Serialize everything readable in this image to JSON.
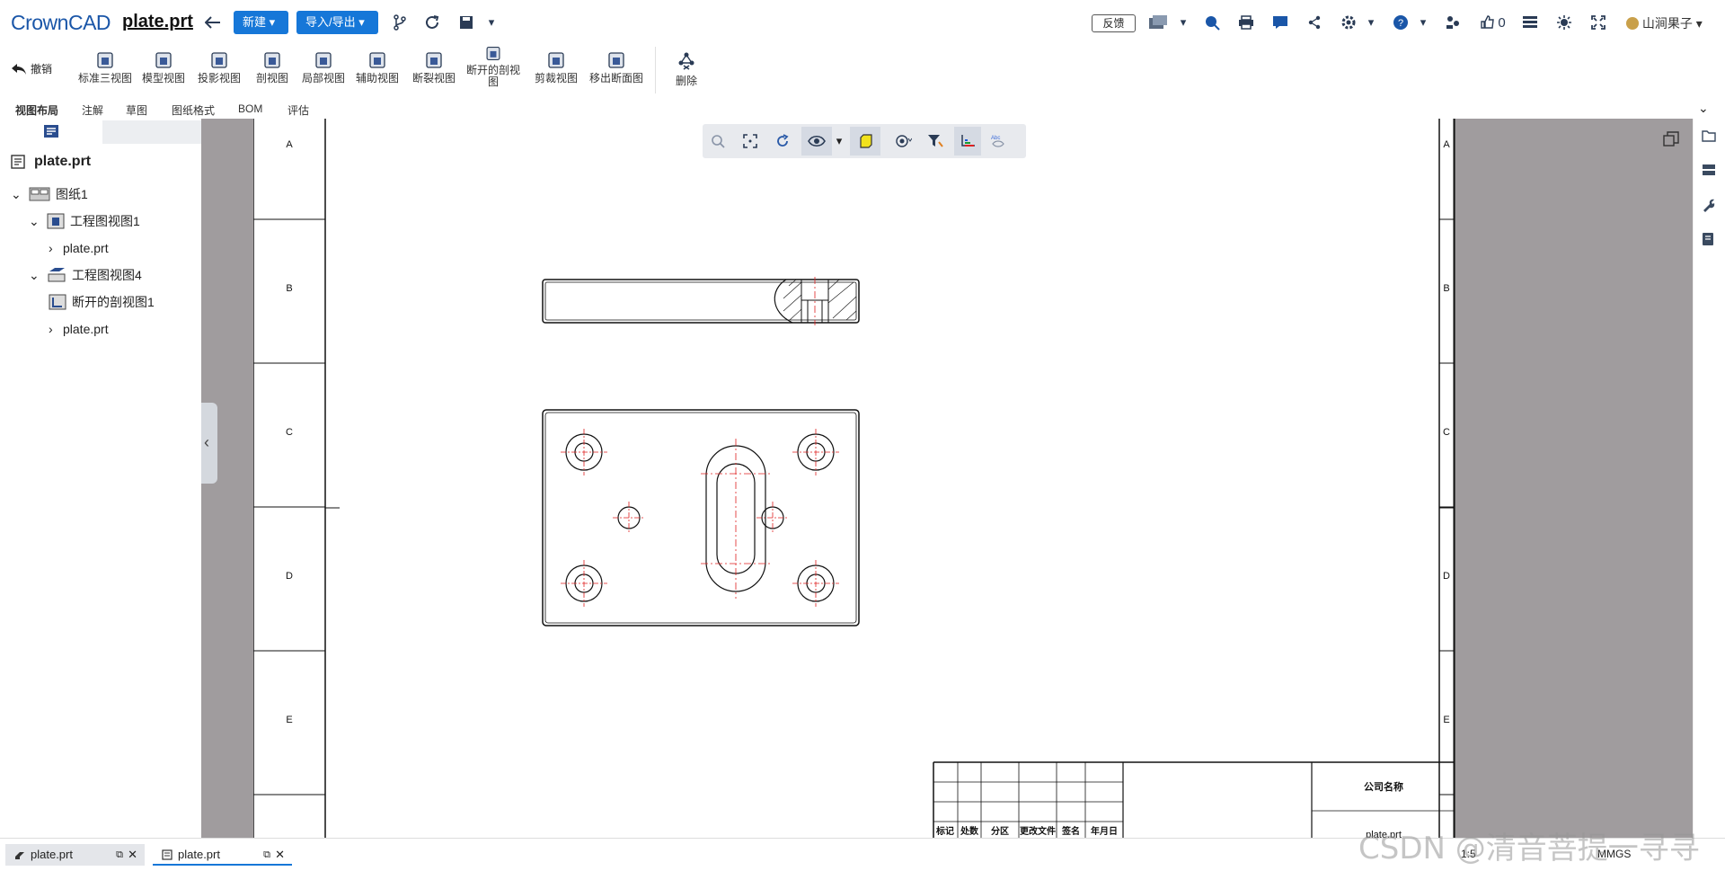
{
  "app": {
    "logo": "CrownCAD",
    "title": "plate.prt"
  },
  "header": {
    "new_label": "新建",
    "import_export_label": "导入/导出",
    "feedback_label": "反馈",
    "like_count": "0",
    "user_name": "山涧果子"
  },
  "ribbon": {
    "undo_label": "撤销",
    "items": [
      {
        "label": "标准三视图"
      },
      {
        "label": "模型视图"
      },
      {
        "label": "投影视图"
      },
      {
        "label": "剖视图"
      },
      {
        "label": "局部视图"
      },
      {
        "label": "辅助视图"
      },
      {
        "label": "断裂视图"
      },
      {
        "label": "断开的剖视图"
      },
      {
        "label": "剪裁视图"
      },
      {
        "label": "移出断面图"
      }
    ],
    "delete_label": "删除"
  },
  "tabs": [
    {
      "label": "视图布局",
      "active": true
    },
    {
      "label": "注解"
    },
    {
      "label": "草图"
    },
    {
      "label": "图纸格式"
    },
    {
      "label": "BOM"
    },
    {
      "label": "评估"
    }
  ],
  "tree": {
    "root": "plate.prt",
    "sheet": "图纸1",
    "view1": "工程图视图1",
    "view1_child": "plate.prt",
    "view4": "工程图视图4",
    "section": "断开的剖视图1",
    "view4_child": "plate.prt"
  },
  "drawing": {
    "zone_labels_left": [
      "A",
      "B",
      "C",
      "D",
      "E"
    ],
    "zone_labels_right": [
      "A",
      "B",
      "C",
      "D",
      "E"
    ],
    "title_block": {
      "company": "公司名称",
      "part": "plate.prt",
      "scale": "1:5",
      "unit": "MMGS",
      "headers": [
        "标记",
        "处数",
        "分区",
        "更改文件",
        "签名",
        "年月日"
      ]
    }
  },
  "bottom_tabs": [
    {
      "label": "plate.prt"
    },
    {
      "label": "plate.prt",
      "active": true
    }
  ],
  "watermark": "CSDN @清音菩提一寻寻",
  "colors": {
    "accent": "#1677d8",
    "canvas_bg": "#a09c9e",
    "centerline": "#e02020"
  }
}
